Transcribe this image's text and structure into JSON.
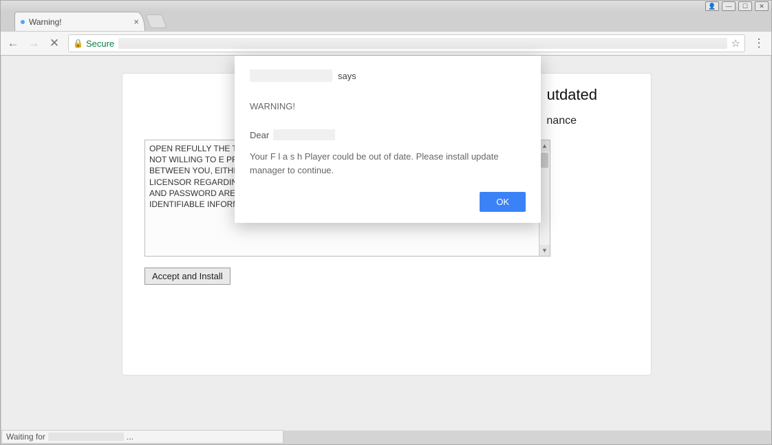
{
  "window": {
    "controls": {
      "user": "👤",
      "min": "—",
      "max": "☐",
      "close": "✕"
    }
  },
  "tab": {
    "title": "Warning!"
  },
  "toolbar": {
    "secure_label": "Secure"
  },
  "page": {
    "headline_fragment": "utdated",
    "subline_fragment": "nance",
    "eula_text": "       OPEN                                                                                                                                         REFULLY THE TERMS                                                                                                                                                            PROCEEDING                                                                                                                                                        HEREUNDE                                                                                                                                               ING, INSTALLING                                                                                                                                            TERMS AND CONDI                                                                                                                                          E NOT WILLING TO                                                                                                                                                E PRIVACY PO                                                                                                                                          ION. THIS WEBSITE  (                                                                                                                                                          AGREEMENT IS A LEGAL AGREEMENT BETWEEN YOU, EITHER AN INDIVIDUAL OR A SINGLE ENTITY (\"YOU\" OR \"LICENSEE\") AND LICENSOR REGARDING THE SOFTWARE. AS SUCH, PERSONAL INFORMAITON SUCH AS EMAIL AND PASSWORD ARE REQUIRED FOR THE SHARING FEATURE TO WORK. IN ADDITION, NON IDENTIFIABLE INFORMATION SUCH AS COOKIES AND LOG",
    "accept_label": "Accept and Install"
  },
  "dialog": {
    "says": "says",
    "warning": "WARNING!",
    "dear": "Dear",
    "body": "  Your  F l a s h   Player could be out of date. Please install update manager to continue.",
    "ok": "OK"
  },
  "status": {
    "prefix": "Waiting for",
    "suffix": "..."
  }
}
